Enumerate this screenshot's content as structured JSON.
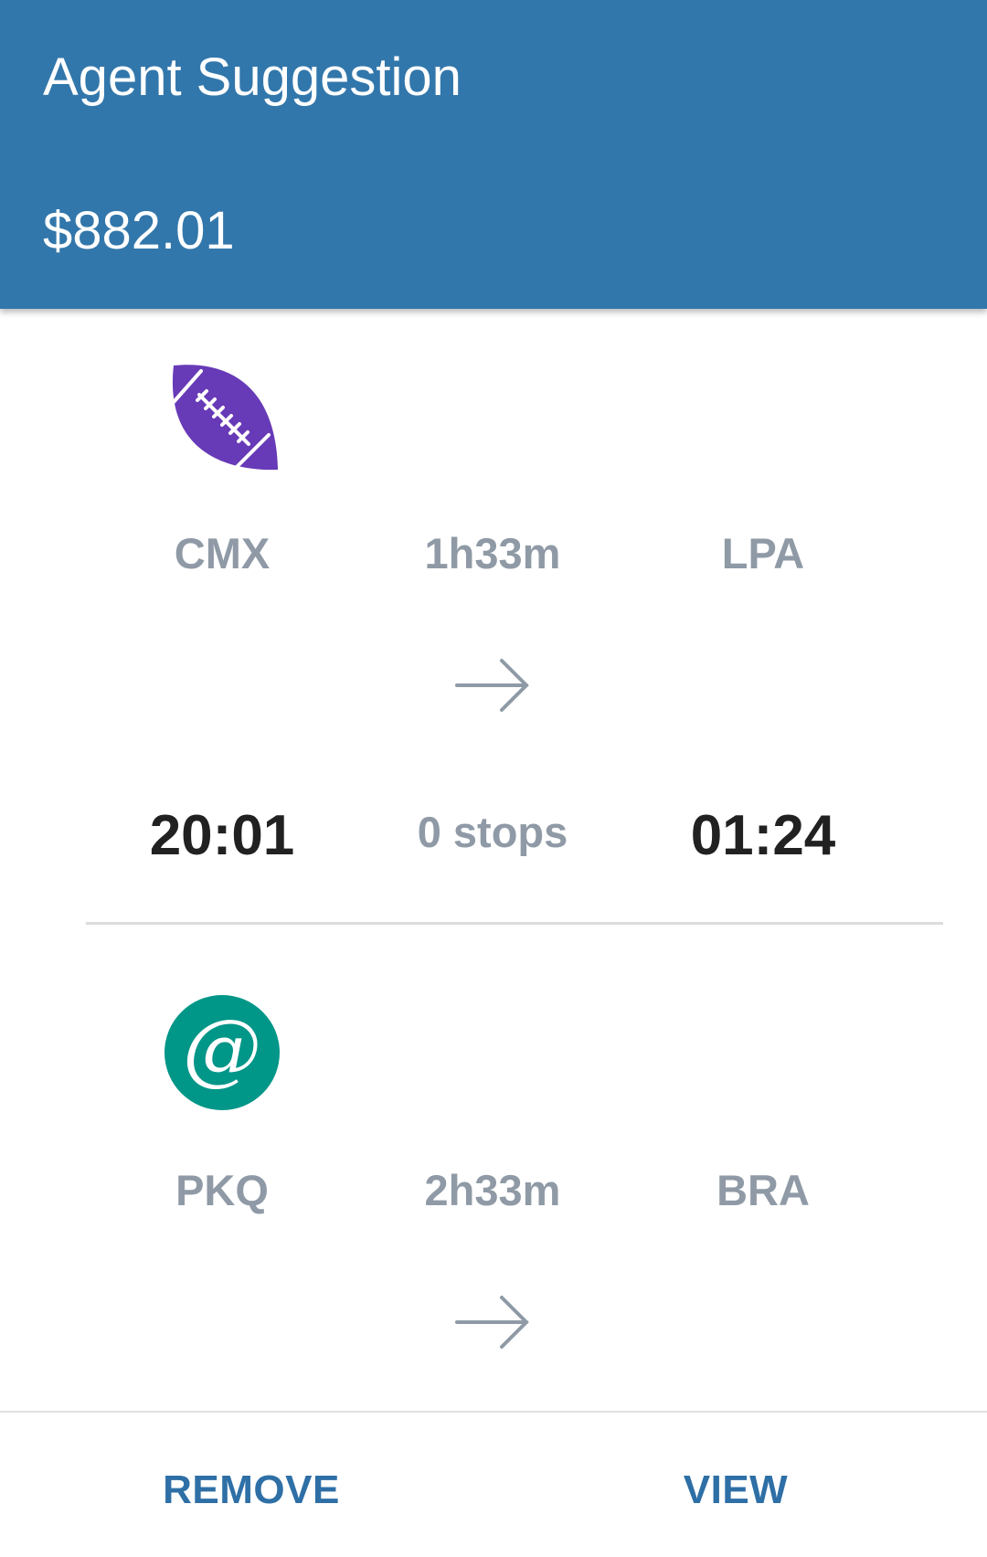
{
  "header": {
    "title": "Agent Suggestion",
    "price": "$882.01",
    "background_color": "#3277ab"
  },
  "segments": [
    {
      "airline_icon": "football-icon",
      "airline_color": "#673ab7",
      "origin": "CMX",
      "duration": "1h33m",
      "destination": "LPA",
      "departure_time": "20:01",
      "stops": "0 stops",
      "arrival_time": "01:24"
    },
    {
      "airline_icon": "at-sign-icon",
      "airline_color": "#009688",
      "origin": "PKQ",
      "duration": "2h33m",
      "destination": "BRA"
    }
  ],
  "footer": {
    "remove_label": "REMOVE",
    "view_label": "VIEW",
    "accent_color": "#2e6fa6"
  }
}
